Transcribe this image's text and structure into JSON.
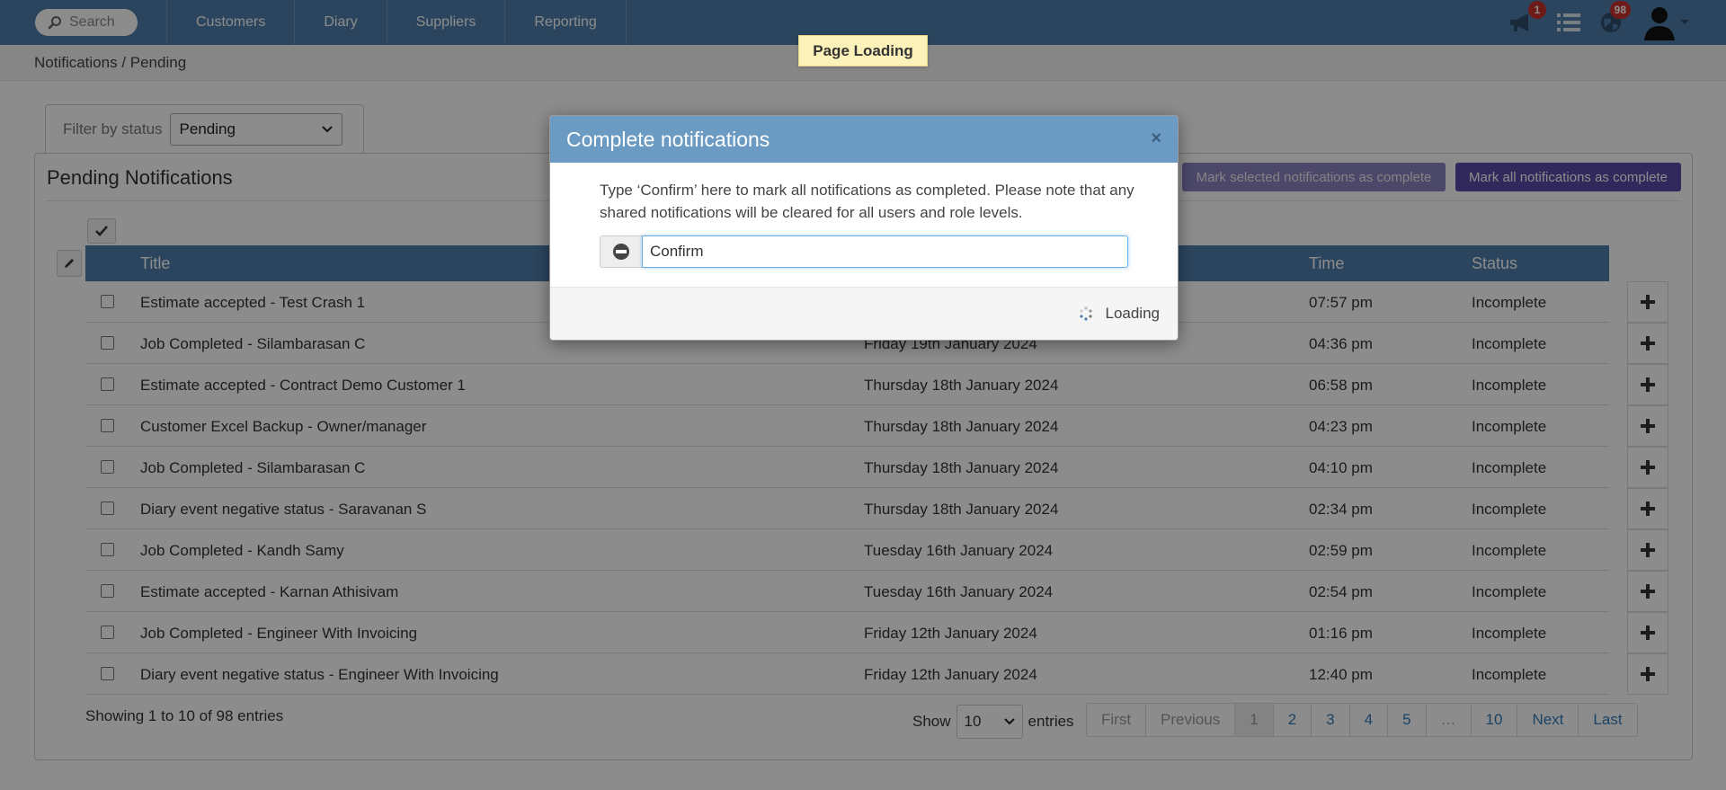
{
  "nav": {
    "search_placeholder": "Search",
    "links": [
      "Customers",
      "Diary",
      "Suppliers",
      "Reporting"
    ],
    "announcement_badge": "1",
    "globe_badge": "98"
  },
  "breadcrumb": "Notifications / Pending",
  "page_loading": "Page Loading",
  "filter": {
    "label": "Filter by status",
    "value": "Pending"
  },
  "panel": {
    "title": "Pending Notifications",
    "mark_selected": "Mark selected notifications as complete",
    "mark_all": "Mark all notifications as complete"
  },
  "table": {
    "headers": {
      "title": "Title",
      "time": "Time",
      "status": "Status"
    },
    "rows": [
      {
        "title": "Estimate accepted - Test Crash 1",
        "date": "",
        "time": "07:57 pm",
        "status": "Incomplete"
      },
      {
        "title": "Job Completed - Silambarasan C",
        "date": "Friday 19th January 2024",
        "time": "04:36 pm",
        "status": "Incomplete"
      },
      {
        "title": "Estimate accepted - Contract Demo Customer 1",
        "date": "Thursday 18th January 2024",
        "time": "06:58 pm",
        "status": "Incomplete"
      },
      {
        "title": "Customer Excel Backup - Owner/manager",
        "date": "Thursday 18th January 2024",
        "time": "04:23 pm",
        "status": "Incomplete"
      },
      {
        "title": "Job Completed - Silambarasan C",
        "date": "Thursday 18th January 2024",
        "time": "04:10 pm",
        "status": "Incomplete"
      },
      {
        "title": "Diary event negative status - Saravanan S",
        "date": "Thursday 18th January 2024",
        "time": "02:34 pm",
        "status": "Incomplete"
      },
      {
        "title": "Job Completed - Kandh Samy",
        "date": "Tuesday 16th January 2024",
        "time": "02:59 pm",
        "status": "Incomplete"
      },
      {
        "title": "Estimate accepted - Karnan Athisivam",
        "date": "Tuesday 16th January 2024",
        "time": "02:54 pm",
        "status": "Incomplete"
      },
      {
        "title": "Job Completed - Engineer With Invoicing",
        "date": "Friday 12th January 2024",
        "time": "01:16 pm",
        "status": "Incomplete"
      },
      {
        "title": "Diary event negative status - Engineer With Invoicing",
        "date": "Friday 12th January 2024",
        "time": "12:40 pm",
        "status": "Incomplete"
      }
    ]
  },
  "footer": {
    "info": "Showing 1 to 10 of 98 entries",
    "show": "Show",
    "page_length": "10",
    "entries": "entries",
    "pager": [
      "First",
      "Previous",
      "1",
      "2",
      "3",
      "4",
      "5",
      "…",
      "10",
      "Next",
      "Last"
    ]
  },
  "modal": {
    "title": "Complete notifications",
    "close": "×",
    "text": "Type ‘Confirm’ here to mark all notifications as completed. Please note that any shared notifications will be cleared for all users and role levels.",
    "input_value": "Confirm",
    "footer_loading": "Loading"
  },
  "colors": {
    "nav_bg": "#4f7fab",
    "modal_header": "#6b9bc2",
    "mark_all_button": "#5a4aa8",
    "badge": "#c9302c"
  }
}
